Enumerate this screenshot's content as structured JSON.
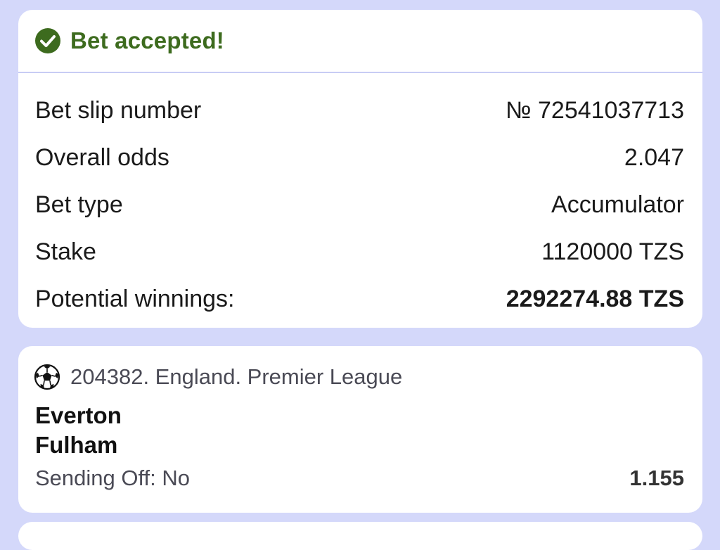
{
  "header": {
    "title": "Bet accepted!",
    "icon": "check-circle-icon",
    "accent": "#3d6b1e"
  },
  "summary": {
    "rows": [
      {
        "label": "Bet slip number",
        "value": "№ 72541037713"
      },
      {
        "label": "Overall odds",
        "value": "2.047"
      },
      {
        "label": "Bet type",
        "value": "Accumulator"
      },
      {
        "label": "Stake",
        "value": "1120000 TZS"
      },
      {
        "label": "Potential winnings:",
        "value": "2292274.88 TZS"
      }
    ]
  },
  "event": {
    "icon": "soccer-ball-icon",
    "league": "204382. England. Premier League",
    "team_home": "Everton",
    "team_away": "Fulham",
    "selection": "Sending Off: No",
    "odds": "1.155"
  }
}
